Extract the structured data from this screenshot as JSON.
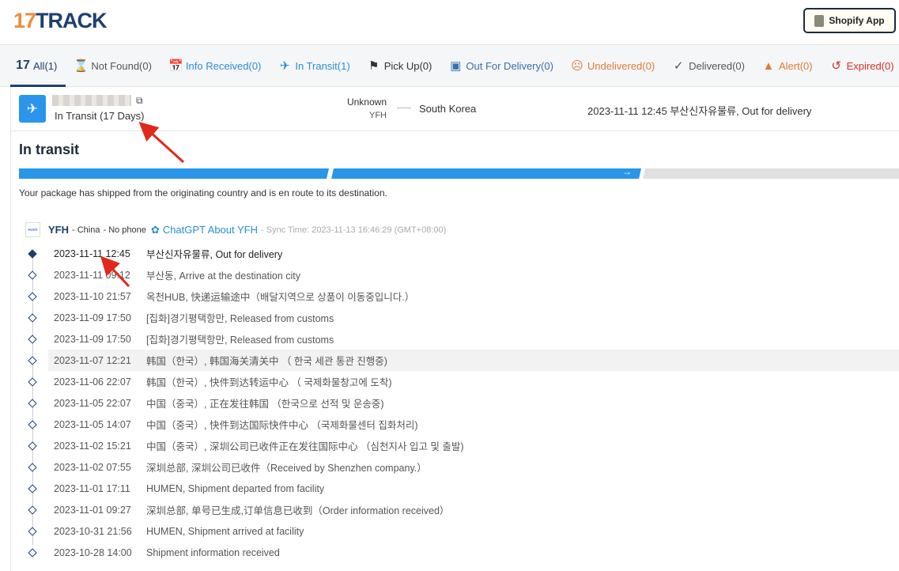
{
  "header": {
    "logo_num": "17",
    "logo_text": "TRACK",
    "shopify_label": "Shopify App"
  },
  "nav": {
    "tabs": [
      {
        "label": "All(1)",
        "icon": "17-logo-icon",
        "color": "#1d3f6e"
      },
      {
        "label": "Not Found(0)",
        "icon": "hourglass-icon",
        "color": "#555555"
      },
      {
        "label": "Info Received(0)",
        "icon": "calendar-clock-icon",
        "color": "#2a8fd6"
      },
      {
        "label": "In Transit(1)",
        "icon": "plane-icon",
        "color": "#2a8fd6"
      },
      {
        "label": "Pick Up(0)",
        "icon": "flag-icon",
        "color": "#333333"
      },
      {
        "label": "Out For Delivery(0)",
        "icon": "delivery-icon",
        "color": "#3a6fae"
      },
      {
        "label": "Undelivered(0)",
        "icon": "sad-face-icon",
        "color": "#e07b39"
      },
      {
        "label": "Delivered(0)",
        "icon": "check-icon",
        "color": "#555555"
      },
      {
        "label": "Alert(0)",
        "icon": "warning-icon",
        "color": "#e07b39"
      },
      {
        "label": "Expired(0)",
        "icon": "history-icon",
        "color": "#d9302c"
      }
    ]
  },
  "summary": {
    "status": "In Transit (17 Days)",
    "origin": "Unknown",
    "carrier_code": "YFH",
    "destination": "South Korea",
    "latest": "2023-11-11 12:45 부산신자유물류, Out for delivery"
  },
  "detail": {
    "title": "In transit",
    "progress_segments_complete": 2,
    "progress_segments_total": 3,
    "description": "Your package has shipped from the originating country and is en route to its destination.",
    "carrier": {
      "name": "YFH",
      "country": "- China",
      "phone": "- No phone",
      "chatgpt": "ChatGPT About YFH",
      "sync": "- Sync Time: 2023-11-13 16:46:29 (GMT+08:00)"
    },
    "events": [
      {
        "time": "2023-11-11 12:45",
        "text": "부산신자유물류, Out for delivery"
      },
      {
        "time": "2023-11-11 09:12",
        "text": "부산동, Arrive at the destination city"
      },
      {
        "time": "2023-11-10 21:57",
        "text": "옥천HUB, 快递运输途中（배달지역으로 상품이 이동중입니다.）"
      },
      {
        "time": "2023-11-09 17:50",
        "text": "[집화]경기평택항만, Released from customs"
      },
      {
        "time": "2023-11-09 17:50",
        "text": "[집화]경기평택항만, Released from customs"
      },
      {
        "time": "2023-11-07 12:21",
        "text": "韩国（한국）, 韩国海关清关中 （ 한국 세관 통관 진행중)"
      },
      {
        "time": "2023-11-06 22:07",
        "text": "韩国（한국）, 快件到达转运中心 （ 국제화물창고에 도착)"
      },
      {
        "time": "2023-11-05 22:07",
        "text": "中国（중국）, 正在发往韩国 （한국으로 선적 및 운송중)"
      },
      {
        "time": "2023-11-05 14:07",
        "text": "中国（중국）, 快件到达国际快件中心 （국제화물센터 집화처리)"
      },
      {
        "time": "2023-11-02 15:21",
        "text": "中国（중국）, 深圳公司已收件正在发往国际中心 （심천지사 입고 및 출발)"
      },
      {
        "time": "2023-11-02 07:55",
        "text": "深圳总部, 深圳公司已收件（Received by Shenzhen company.）"
      },
      {
        "time": "2023-11-01 17:11",
        "text": "HUMEN, Shipment departed from facility"
      },
      {
        "time": "2023-11-01 09:27",
        "text": "深圳总部, 单号已生成,订单信息已收到（Order information received）"
      },
      {
        "time": "2023-10-31 21:56",
        "text": "HUMEN, Shipment arrived at facility"
      },
      {
        "time": "2023-10-28 14:00",
        "text": "Shipment information received"
      }
    ]
  }
}
